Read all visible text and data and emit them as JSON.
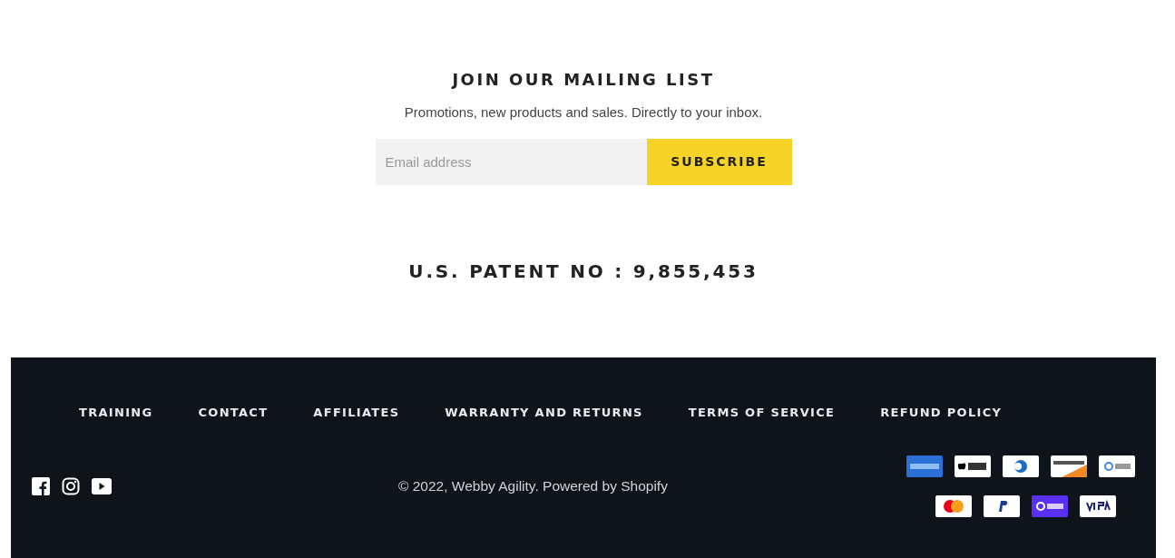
{
  "newsletter": {
    "title": "JOIN OUR MAILING LIST",
    "text": "Promotions, new products and sales. Directly to your inbox.",
    "email_field": {
      "placeholder": "Email address"
    },
    "button": "SUBSCRIBE"
  },
  "patent": "U.S. PATENT NO : 9,855,453",
  "footer": {
    "links": [
      "TRAINING",
      "CONTACT",
      "AFFILIATES",
      "WARRANTY AND RETURNS",
      "TERMS OF SERVICE",
      "REFUND POLICY"
    ],
    "copyright": "© 2022, Webby Agility. Powered by Shopify"
  }
}
